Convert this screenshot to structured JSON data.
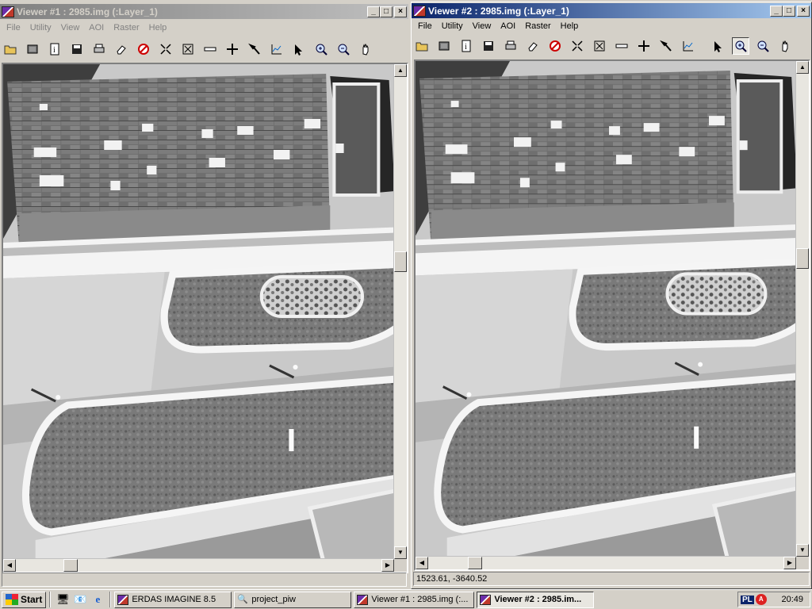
{
  "viewer1": {
    "title": "Viewer #1 : 2985.img (:Layer_1)",
    "menu": [
      "File",
      "Utility",
      "View",
      "AOI",
      "Raster",
      "Help"
    ],
    "status": ""
  },
  "viewer2": {
    "title": "Viewer #2 : 2985.img (:Layer_1)",
    "menu": [
      "File",
      "Utility",
      "View",
      "AOI",
      "Raster",
      "Help"
    ],
    "status": "1523.61, -3640.52"
  },
  "window_buttons": {
    "minimize": "_",
    "maximize": "□",
    "close": "×"
  },
  "toolbar_icons": [
    "open-folder-icon",
    "open-image-icon",
    "info-icon",
    "save-icon",
    "print-icon",
    "eraser-icon",
    "measure-icon",
    "fit-to-window-icon",
    "fullscreen-icon",
    "ruler-icon",
    "crosshair-icon",
    "hammer-icon",
    "profile-icon",
    "pointer-icon",
    "zoom-in-icon",
    "zoom-out-icon",
    "pan-hand-icon"
  ],
  "taskbar": {
    "start": "Start",
    "tasks": [
      "ERDAS IMAGINE 8.5",
      "project_piw",
      "Viewer #1 : 2985.img (:...",
      "Viewer #2 : 2985.im..."
    ],
    "tray_language": "PL",
    "tray_ad": "A",
    "clock": "20:49"
  },
  "colors": {
    "active_title": "#0a246a",
    "inactive_title": "#808080",
    "face": "#d4d0c8"
  }
}
